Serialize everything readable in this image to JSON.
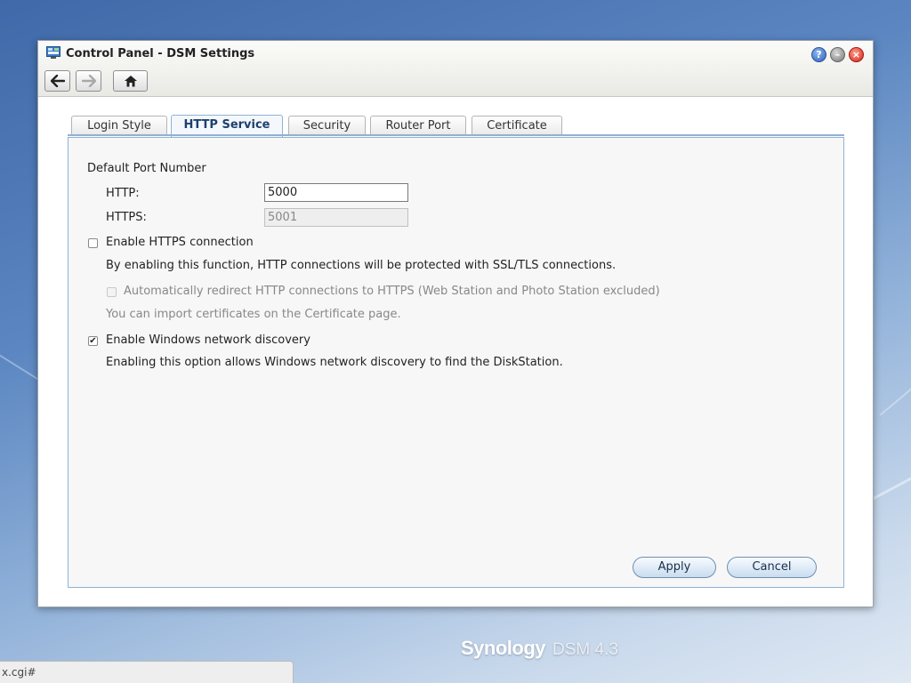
{
  "window": {
    "title": "Control Panel - DSM Settings"
  },
  "icons": {
    "app": "control-panel-icon",
    "help": "help-icon",
    "minimize": "minimize-icon",
    "close": "close-icon",
    "back": "back-arrow-icon",
    "forward": "forward-arrow-icon",
    "home": "home-icon"
  },
  "tabs": [
    {
      "label": "Login Style",
      "active": false
    },
    {
      "label": "HTTP Service",
      "active": true
    },
    {
      "label": "Security",
      "active": false
    },
    {
      "label": "Router Port",
      "active": false
    },
    {
      "label": "Certificate",
      "active": false
    }
  ],
  "form": {
    "section_title": "Default Port Number",
    "http_label": "HTTP:",
    "http_value": "5000",
    "https_label": "HTTPS:",
    "https_value": "5001",
    "enable_https": {
      "label": "Enable HTTPS connection",
      "checked": false,
      "description": "By enabling this function, HTTP connections will be protected with SSL/TLS connections."
    },
    "redirect": {
      "label": "Automatically redirect HTTP connections to HTTPS (Web Station and Photo Station excluded)",
      "checked": false,
      "disabled": true
    },
    "cert_note": "You can import certificates on the Certificate page.",
    "windows_discovery": {
      "label": "Enable Windows network discovery",
      "checked": true,
      "description": "Enabling this option allows Windows network discovery to find the DiskStation."
    }
  },
  "buttons": {
    "apply": "Apply",
    "cancel": "Cancel"
  },
  "branding": {
    "name": "Synology",
    "version": "DSM 4.3"
  },
  "statusbar": {
    "url": "x.cgi#"
  },
  "colors": {
    "accent": "#1d3f6e",
    "panel_border": "#8fb2d4",
    "close_red": "#d0271b",
    "help_blue": "#2f62b8"
  }
}
